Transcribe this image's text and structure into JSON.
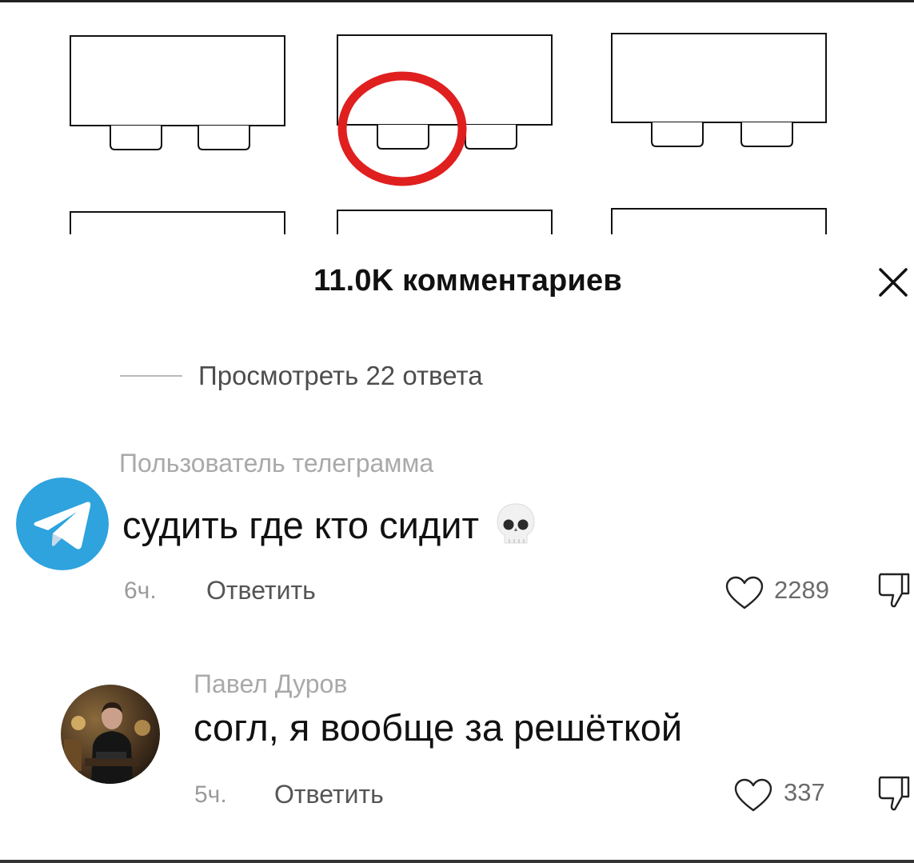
{
  "header": {
    "title": "11.0K комментариев"
  },
  "replies": {
    "view_label": "Просмотреть 22 ответа"
  },
  "comments": [
    {
      "username": "Пользователь  телеграмма",
      "text": "судить где кто сидит",
      "emoji": "skull",
      "time": "6ч.",
      "reply_label": "Ответить",
      "likes": "2289",
      "avatar": "telegram-logo"
    },
    {
      "username": "Павел  Дуров",
      "text": "согл, я вообще за решёткой",
      "time": "5ч.",
      "reply_label": "Ответить",
      "likes": "337",
      "avatar": "user-photo"
    }
  ],
  "colors": {
    "highlight_circle": "#e01f1f",
    "telegram_blue": "#2ea3de",
    "muted_text": "#a9a9a9"
  }
}
